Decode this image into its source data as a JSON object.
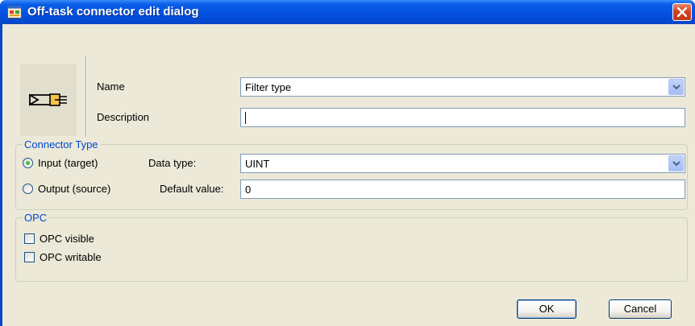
{
  "window": {
    "title": "Off-task connector edit dialog",
    "app_icon": "dialog-app-icon",
    "close_icon": "close-icon",
    "colors": {
      "titlebar": "#0453e2",
      "client": "#ece9d8",
      "group_label": "#0046d5"
    }
  },
  "connector_icon": "connector-icon",
  "name": {
    "label": "Name",
    "value": "Filter type",
    "dropdown_icon": "chevron-down-icon"
  },
  "description": {
    "label": "Description",
    "value": ""
  },
  "connector_type": {
    "legend": "Connector Type",
    "input_option": "Input (target)",
    "output_option": "Output (source)",
    "selected": "Input (target)",
    "data_type": {
      "label": "Data type:",
      "value": "UINT"
    },
    "default_value": {
      "label": "Default value:",
      "value": "0"
    }
  },
  "opc": {
    "legend": "OPC",
    "visible": {
      "label": "OPC visible",
      "checked": false
    },
    "writable": {
      "label": "OPC writable",
      "checked": false
    }
  },
  "buttons": {
    "ok": "OK",
    "cancel": "Cancel"
  }
}
